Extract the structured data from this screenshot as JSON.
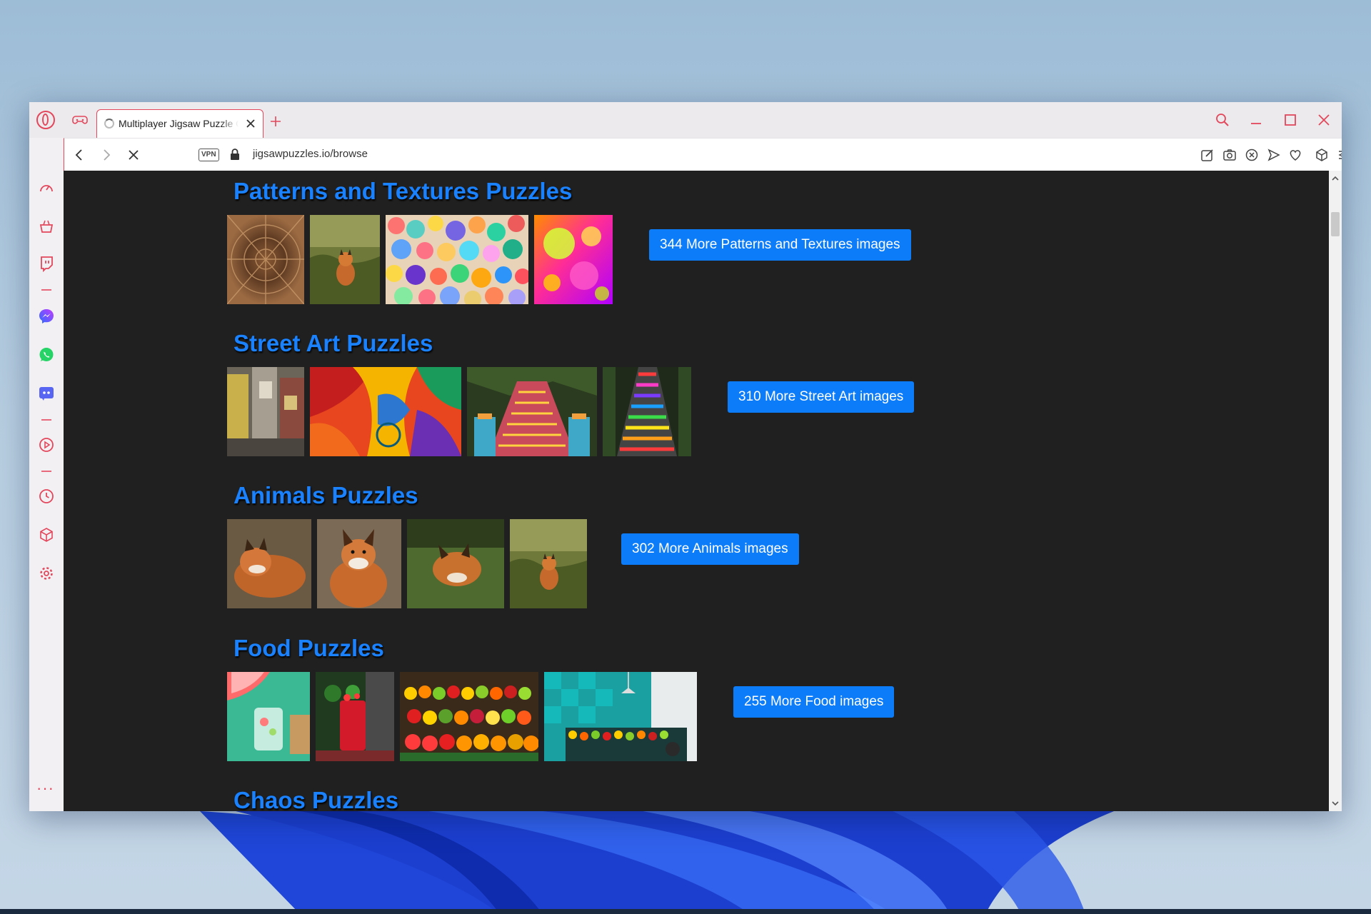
{
  "browser": {
    "tab_title": "Multiplayer Jigsaw Puzzle Online",
    "url": "jigsawpuzzles.io/browse",
    "vpn_label": "VPN",
    "accent_color": "#e3475c"
  },
  "sidebar": {
    "items": [
      {
        "icon": "speed-dial-icon"
      },
      {
        "icon": "shopping-icon"
      },
      {
        "icon": "twitch-icon"
      },
      {
        "icon": "messenger-icon"
      },
      {
        "icon": "whatsapp-icon"
      },
      {
        "icon": "discord-icon"
      },
      {
        "icon": "player-icon"
      },
      {
        "icon": "history-icon"
      },
      {
        "icon": "extensions-icon"
      },
      {
        "icon": "settings-icon"
      }
    ],
    "more_label": "···"
  },
  "page": {
    "background": "#202020",
    "title_color": "#1a82ff",
    "button_color": "#0d7cf8",
    "sections": [
      {
        "title": "Patterns and Textures Puzzles",
        "button": "344 More Patterns and Textures images"
      },
      {
        "title": "Street Art Puzzles",
        "button": "310 More Street Art images"
      },
      {
        "title": "Animals Puzzles",
        "button": "302 More Animals images"
      },
      {
        "title": "Food Puzzles",
        "button": "255 More Food images"
      },
      {
        "title": "Chaos Puzzles",
        "button": ""
      }
    ]
  }
}
